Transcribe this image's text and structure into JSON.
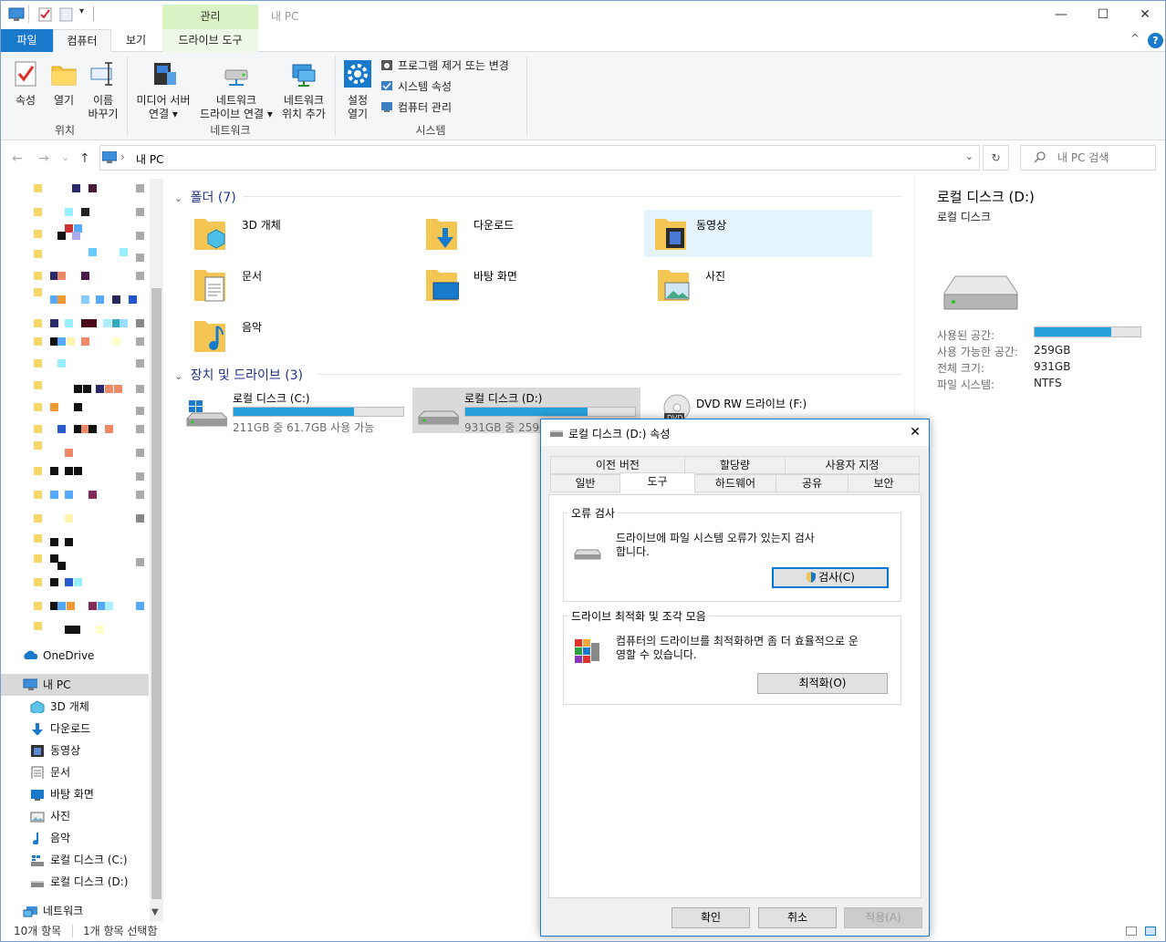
{
  "window": {
    "title": "내 PC",
    "context_tab": "관리",
    "controls": {
      "minimize": "—",
      "maximize": "☐",
      "close": "✕"
    }
  },
  "ribbon_tabs": {
    "file": "파일",
    "computer": "컴퓨터",
    "view": "보기",
    "drive_tools": "드라이브 도구",
    "collapse": "^",
    "help": "?"
  },
  "ribbon": {
    "properties": "속성",
    "open": "열기",
    "rename_1": "이름",
    "rename_2": "바꾸기",
    "location_group": "위치",
    "media_1": "미디어 서버",
    "media_2": "연결 ▾",
    "map_drive_1": "네트워크",
    "map_drive_2": "드라이브 연결 ▾",
    "add_location_1": "네트워크",
    "add_location_2": "위치 추가",
    "network_group": "네트워크",
    "settings_1": "설정",
    "settings_2": "열기",
    "uninstall": "프로그램 제거 또는 변경",
    "system_props": "시스템 속성",
    "manage": "컴퓨터 관리",
    "system_group": "시스템"
  },
  "address": {
    "path_sep": "›",
    "path": "내 PC",
    "search_placeholder": "내 PC 검색",
    "back": "←",
    "forward": "→",
    "recent": "⌄",
    "up": "↑",
    "dropdown": "⌄",
    "refresh": "↻"
  },
  "nav": {
    "onedrive": "OneDrive",
    "this_pc": "내 PC",
    "items": [
      "3D 개체",
      "다운로드",
      "동영상",
      "문서",
      "바탕 화면",
      "사진",
      "음악",
      "로컬 디스크 (C:)",
      "로컬 디스크 (D:)"
    ],
    "network": "네트워크"
  },
  "folders_section": {
    "title": "폴더",
    "count": "(7)",
    "chevron": "⌄"
  },
  "folders": [
    "3D 개체",
    "다운로드",
    "동영상",
    "문서",
    "바탕 화면",
    "사진",
    "음악"
  ],
  "drives_section": {
    "title": "장치 및 드라이브",
    "count": "(3)",
    "chevron": "⌄"
  },
  "drives": [
    {
      "name": "로컬 디스크 (C:)",
      "info": "211GB 중 61.7GB 사용 가능",
      "used_fraction": 0.71
    },
    {
      "name": "로컬 디스크 (D:)",
      "info": "931GB 중 259GB 사용 가능",
      "used_fraction": 0.72
    },
    {
      "name": "DVD RW 드라이브 (F:)",
      "info": ""
    }
  ],
  "details": {
    "title": "로컬 디스크 (D:)",
    "subtitle": "로컬 디스크",
    "used_label": "사용된 공간:",
    "used_fraction": 0.72,
    "free_label": "사용 가능한 공간:",
    "free_value": "259GB",
    "total_label": "전체 크기:",
    "total_value": "931GB",
    "fs_label": "파일 시스템:",
    "fs_value": "NTFS"
  },
  "status": {
    "items": "10개 항목",
    "selected": "1개 항목 선택함"
  },
  "dialog": {
    "title": "로컬 디스크 (D:) 속성",
    "close": "✕",
    "tabs_row1": [
      "이전 버전",
      "할당량",
      "사용자 지정"
    ],
    "tabs_row2": [
      "일반",
      "도구",
      "하드웨어",
      "공유",
      "보안"
    ],
    "error_check": {
      "label": "오류 검사",
      "text_1": "드라이브에 파일 시스템 오류가 있는지 검사",
      "text_2": "합니다.",
      "button": "검사(C)"
    },
    "optimize": {
      "label": "드라이브 최적화 및 조각 모음",
      "text_1": "컴퓨터의 드라이브를 최적화하면 좀 더 효율적으로 운",
      "text_2": "영할 수 있습니다.",
      "button": "최적화(O)"
    },
    "ok": "확인",
    "cancel": "취소",
    "apply": "적용(A)"
  },
  "colors": {
    "accent": "#1979ca",
    "progress": "#26a0da",
    "context_tab": "#d9f2c4"
  }
}
